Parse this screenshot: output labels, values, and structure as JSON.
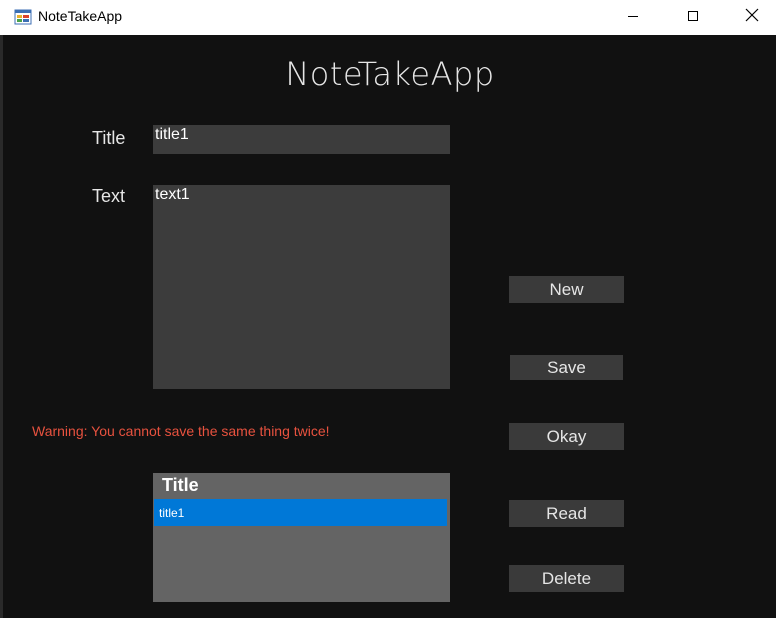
{
  "window": {
    "title": "NoteTakeApp",
    "icon": "winforms-app-icon",
    "controls": {
      "minimize_icon": "minimize-icon",
      "maximize_icon": "maximize-icon",
      "close_icon": "close-icon"
    }
  },
  "header": {
    "heading": "NoteTakeApp"
  },
  "form": {
    "title_label": "Title",
    "title_value": "title1",
    "text_label": "Text",
    "text_value": "text1"
  },
  "status": {
    "warning": "Warning: You cannot save the same thing twice!",
    "warning_color": "#e8523f"
  },
  "buttons": {
    "new_label": "New",
    "save_label": "Save",
    "okay_label": "Okay",
    "read_label": "Read",
    "delete_label": "Delete"
  },
  "notes_list": {
    "column_header": "Title",
    "rows": [
      {
        "title": "title1",
        "selected": true
      }
    ],
    "selection_color": "#0078d7"
  },
  "colors": {
    "background": "#111111",
    "field_background": "#3c3c3c",
    "button_background": "#3a3a3a",
    "list_background": "#646464"
  }
}
